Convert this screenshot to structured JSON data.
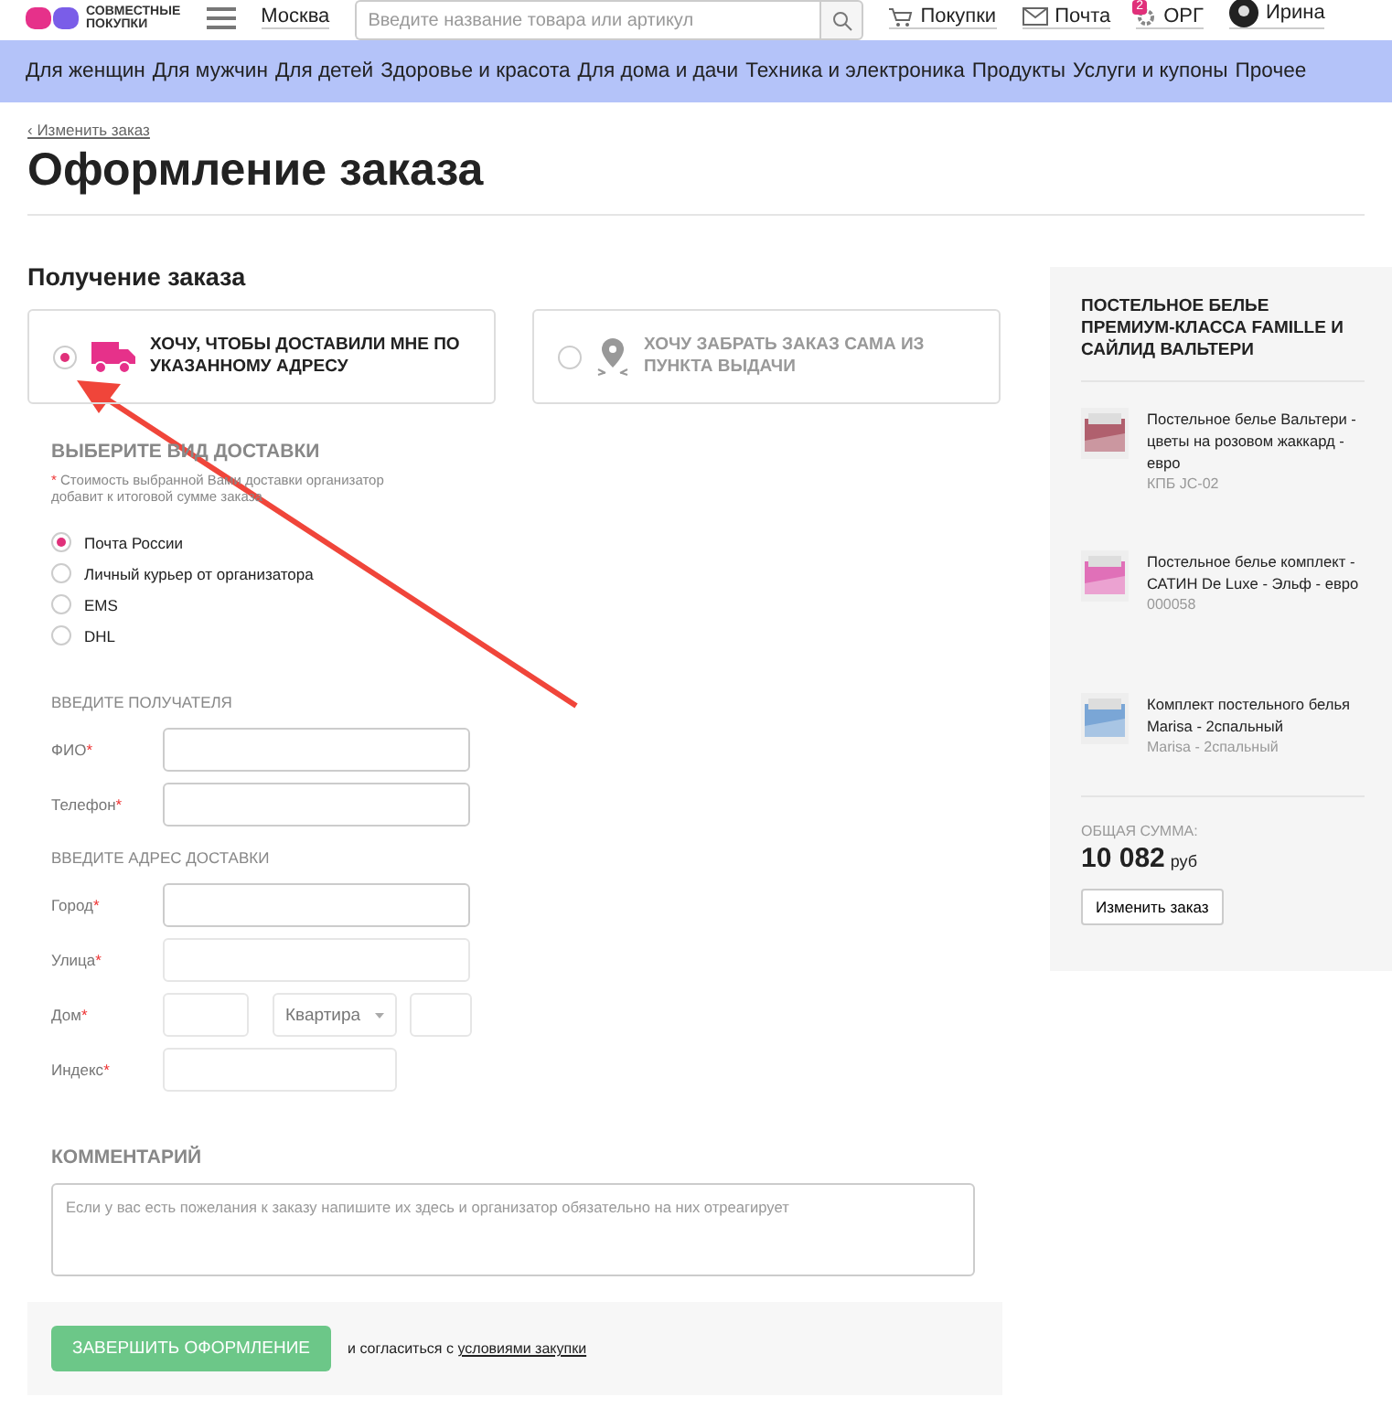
{
  "header": {
    "logo_lines": [
      "СОВМЕСТНЫЕ",
      "ПОКУПКИ"
    ],
    "city": "Москва",
    "search_placeholder": "Введите название товара или артикул",
    "links": [
      {
        "kind": "cart",
        "label": "Покупки"
      },
      {
        "kind": "mail",
        "label": "Почта"
      },
      {
        "kind": "org",
        "label": "ОРГ",
        "badge": "2"
      }
    ],
    "user": "Ирина"
  },
  "categories": [
    "Для женщин",
    "Для мужчин",
    "Для детей",
    "Здоровье и красота",
    "Для дома и дачи",
    "Техника и электроника",
    "Продукты",
    "Услуги и купоны",
    "Прочее"
  ],
  "back_link": "‹ Изменить заказ",
  "title": "Оформление заказа",
  "receiving": {
    "heading": "Получение заказа",
    "options": [
      {
        "kind": "truck",
        "label": "ХОЧУ, ЧТОБЫ ДОСТАВИЛИ МНЕ ПО УКАЗАННОМУ АДРЕСУ",
        "selected": true
      },
      {
        "kind": "pin",
        "label": "ХОЧУ ЗАБРАТЬ ЗАКАЗ САМА ИЗ ПУНКТА ВЫДАЧИ",
        "selected": false
      }
    ]
  },
  "delivery": {
    "heading": "ВЫБЕРИТЕ ВИД ДОСТАВКИ",
    "note_mark": "*",
    "note": "Стоимость выбранной Вами доставки организатор добавит к итоговой сумме заказа",
    "methods": [
      {
        "label": "Почта России",
        "selected": true
      },
      {
        "label": "Личный курьер от организатора",
        "selected": false
      },
      {
        "label": "EMS",
        "selected": false
      },
      {
        "label": "DHL",
        "selected": false
      }
    ]
  },
  "recipient": {
    "heading": "ВВЕДИТЕ ПОЛУЧАТЕЛЯ",
    "fields": [
      {
        "kind": "text",
        "label": "ФИО",
        "required": true
      },
      {
        "kind": "text",
        "label": "Телефон",
        "required": true
      }
    ]
  },
  "address": {
    "heading": "ВВЕДИТЕ АДРЕС ДОСТАВКИ",
    "fields": [
      {
        "kind": "text",
        "label": "Город",
        "required": true
      },
      {
        "kind": "text",
        "label": "Улица",
        "required": true
      },
      {
        "kind": "house",
        "label": "Дом",
        "required": true,
        "select_placeholder": "Квартира"
      },
      {
        "kind": "short",
        "label": "Индекс",
        "required": true
      }
    ]
  },
  "comment": {
    "heading": "КОММЕНТАРИЙ",
    "placeholder": "Если у вас есть пожелания к заказу напишите их здесь и организатор обязательно на них отреагирует"
  },
  "submit": {
    "button": "ЗАВЕРШИТЬ ОФОРМЛЕНИЕ",
    "agree_text": "и согласиться с",
    "terms_link": "условиями закупки"
  },
  "order": {
    "title": "ПОСТЕЛЬНОЕ БЕЛЬЕ ПРЕМИУМ-КЛАССА FAMILLE И САЙЛИД ВАЛЬТЕРИ",
    "items": [
      {
        "name": "Постельное белье Вальтери - цветы на розовом жаккард - евро",
        "code": "КПБ JC-02"
      },
      {
        "name": "Постельное белье комплект - САТИН De Luxe - Эльф - евро",
        "code": "000058"
      },
      {
        "name": "Комплект постельного белья Marisa - 2спальный",
        "code": "Marisa - 2спальный"
      }
    ],
    "total_label": "ОБЩАЯ СУММА:",
    "total": "10 082",
    "currency": "руб",
    "button": "Изменить заказ"
  }
}
